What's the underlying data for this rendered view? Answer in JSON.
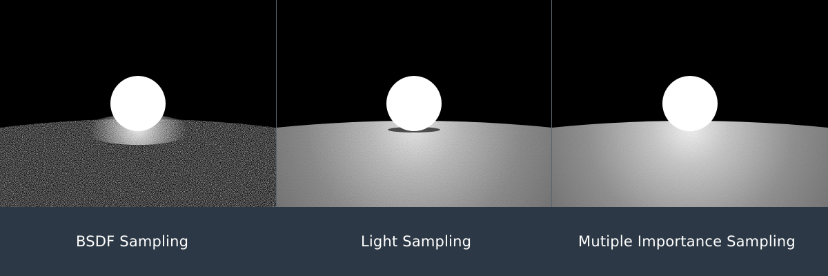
{
  "panels": [
    {
      "id": "bsdf",
      "label": "BSDF Sampling"
    },
    {
      "id": "light",
      "label": "Light Sampling"
    },
    {
      "id": "mis",
      "label": "Mutiple Importance Sampling"
    }
  ],
  "colors": {
    "caption_bar": "#2c3845",
    "caption_text": "#ffffff",
    "background": "#000000",
    "divider": "#5a6470"
  }
}
